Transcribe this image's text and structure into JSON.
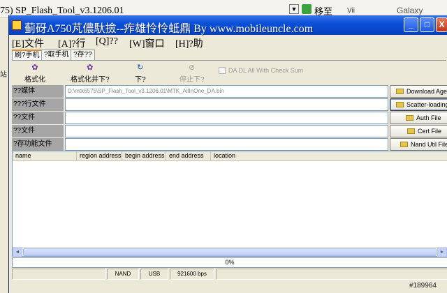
{
  "background": {
    "left_text": "75) SP_Flash_Tool_v3.1206.01",
    "go_text": "移至",
    "right_text_1": "Vii",
    "right_text_2": "Galaxy",
    "side_text": "站"
  },
  "window": {
    "title": "蓟砑A750芃儂馱撿--痄雄怜怜蚳鼎  By  www.mobileuncle.com",
    "minimize_label": "_",
    "maximize_label": "□",
    "close_label": "X"
  },
  "menu": [
    {
      "label": "[E]文件"
    },
    {
      "label": "[A]?行"
    },
    {
      "label": "[Q]??"
    },
    {
      "label": "[W]窗口"
    },
    {
      "label": "[H]?助"
    }
  ],
  "tabs": [
    {
      "label": "刷?手机"
    },
    {
      "label": "?取手机"
    },
    {
      "label": "?存??"
    }
  ],
  "toolbar": {
    "format": "格式化",
    "format_download": "格式化并下?",
    "download": "下?",
    "stop": "停止下?",
    "check_sum": "DA DL All With Check Sum"
  },
  "rows": [
    {
      "label": "??媒体",
      "value": "D:\\mtk6575\\SP_Flash_Tool_v3.1206.01\\MTK_AllInOne_DA.bin",
      "button": "Download Agent"
    },
    {
      "label": "???行文件",
      "value": "",
      "button": "Scatter-loading"
    },
    {
      "label": "??文件",
      "value": "",
      "button": "Auth File"
    },
    {
      "label": "??文件",
      "value": "",
      "button": "Cert File"
    },
    {
      "label": "?存功能文件",
      "value": "",
      "button": "Nand Util File"
    }
  ],
  "list": {
    "columns": [
      "name",
      "region address",
      "begin address",
      "end address",
      "location"
    ]
  },
  "progress": {
    "text": "0%",
    "value": 0
  },
  "status": {
    "storage": "NAND",
    "connection": "USB",
    "baud": "921600 bps"
  },
  "watermark": "#189964"
}
